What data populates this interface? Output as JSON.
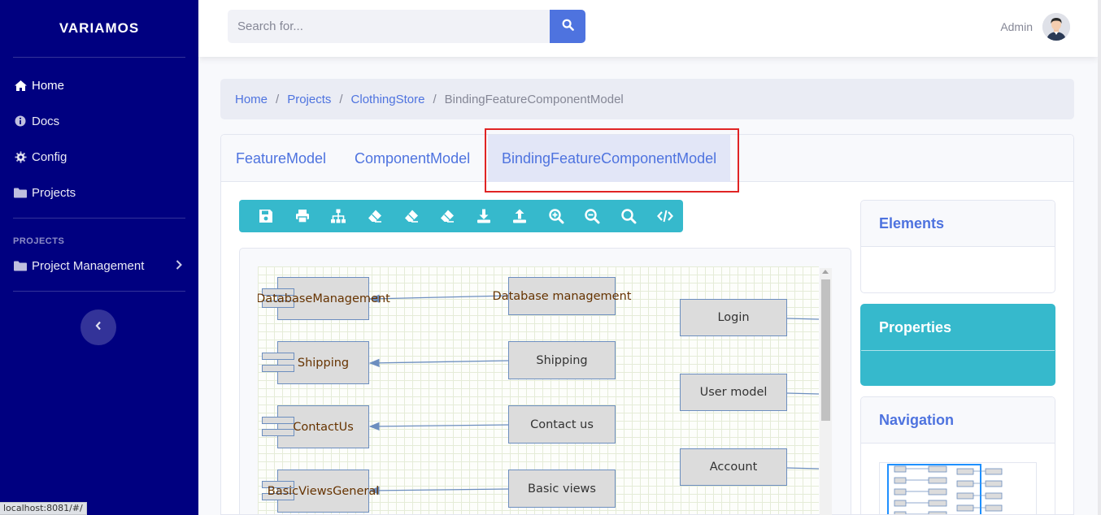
{
  "sidebar": {
    "brand": "VARIAMOS",
    "items": [
      {
        "label": "Home",
        "icon": "home-icon"
      },
      {
        "label": "Docs",
        "icon": "info-icon"
      },
      {
        "label": "Config",
        "icon": "gear-icon"
      },
      {
        "label": "Projects",
        "icon": "folder-icon"
      }
    ],
    "heading": "PROJECTS",
    "project_item": {
      "label": "Project Management",
      "icon": "folder-icon"
    }
  },
  "topbar": {
    "search_placeholder": "Search for...",
    "user_name": "Admin"
  },
  "breadcrumb": [
    "Home",
    "Projects",
    "ClothingStore",
    "BindingFeatureComponentModel"
  ],
  "tabs": [
    "FeatureModel",
    "ComponentModel",
    "BindingFeatureComponentModel"
  ],
  "active_tab": "BindingFeatureComponentModel",
  "toolbar": [
    "save-icon",
    "print-icon",
    "sitemap-icon",
    "eraser-icon",
    "eraser-icon",
    "eraser-icon",
    "download-icon",
    "upload-icon",
    "zoom-in-icon",
    "zoom-out-icon",
    "search-icon",
    "code-icon"
  ],
  "diagram": {
    "components": [
      "DatabaseManagement",
      "Shipping",
      "ContactUs",
      "BasicViewsGeneral"
    ],
    "features_middle": [
      "Database management",
      "Shipping",
      "Contact us",
      "Basic views"
    ],
    "features_right": [
      "Login",
      "User model",
      "Account"
    ]
  },
  "panels": {
    "elements": "Elements",
    "properties": "Properties",
    "navigation": "Navigation"
  },
  "status_url": "localhost:8081/#/",
  "colors": {
    "sidebar": "#000080",
    "primary": "#4e73df",
    "info": "#36b9cc",
    "highlight": "#e02424"
  }
}
